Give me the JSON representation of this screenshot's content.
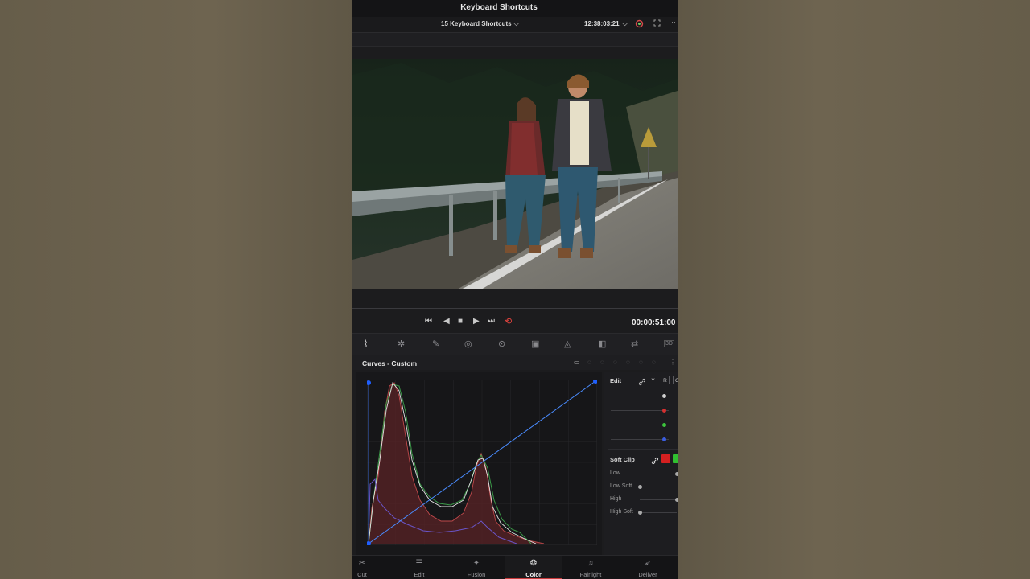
{
  "window": {
    "title": "Keyboard Shortcuts"
  },
  "viewer": {
    "clip_name": "15 Keyboard Shortcuts",
    "clip_chevron": "⌵",
    "timecode_top": "12:38:03:21",
    "timecode_chevron": "⌵",
    "more_icon": "···"
  },
  "transport": {
    "timecode": "00:00:51:00",
    "icons": [
      "skip-to-start-icon",
      "step-back-icon",
      "stop-icon",
      "play-icon",
      "skip-to-end-icon",
      "loop-icon"
    ]
  },
  "palettes": [
    {
      "name": "curves",
      "glyph": "⌇",
      "active": true
    },
    {
      "name": "color-warper",
      "glyph": "✲",
      "active": false
    },
    {
      "name": "qualifier",
      "glyph": "✎",
      "active": false
    },
    {
      "name": "window",
      "glyph": "◎",
      "active": false
    },
    {
      "name": "tracker",
      "glyph": "⊙",
      "active": false
    },
    {
      "name": "magic-mask",
      "glyph": "▣",
      "active": false
    },
    {
      "name": "blur",
      "glyph": "◬",
      "active": false
    },
    {
      "name": "key",
      "glyph": "◧",
      "active": false
    },
    {
      "name": "sizing",
      "glyph": "⇄",
      "active": false
    },
    {
      "name": "3d",
      "glyph": "3D",
      "active": false
    }
  ],
  "curves": {
    "title": "Curves - Custom",
    "mode_icons": [
      "▭",
      "◌",
      "◌",
      "◌",
      "◌",
      "◌",
      "◌"
    ],
    "accent_color": "#4a8cff"
  },
  "edit_panel": {
    "label": "Edit",
    "channel_buttons": [
      "Y",
      "R",
      "G"
    ],
    "channel_colors": [
      "#cfcfcf",
      "#d43030",
      "#3cc43c",
      "#3a5de0"
    ],
    "channel_values": [
      0.92,
      0.92,
      0.92,
      0.92
    ]
  },
  "soft_clip": {
    "label": "Soft Clip",
    "chip_colors": [
      "#d42020",
      "#30c030"
    ],
    "rows": [
      {
        "label": "Low",
        "value": 1.0
      },
      {
        "label": "Low Soft",
        "value": 0.0
      },
      {
        "label": "High",
        "value": 1.0
      },
      {
        "label": "High Soft",
        "value": 0.0
      }
    ]
  },
  "pages": [
    {
      "label": "Cut",
      "icon": "✂",
      "active": false
    },
    {
      "label": "Edit",
      "icon": "☰",
      "active": false
    },
    {
      "label": "Fusion",
      "icon": "✦",
      "active": false
    },
    {
      "label": "Color",
      "icon": "❂",
      "active": true
    },
    {
      "label": "Fairlight",
      "icon": "♫",
      "active": false
    },
    {
      "label": "Deliver",
      "icon": "➶",
      "active": false
    }
  ]
}
